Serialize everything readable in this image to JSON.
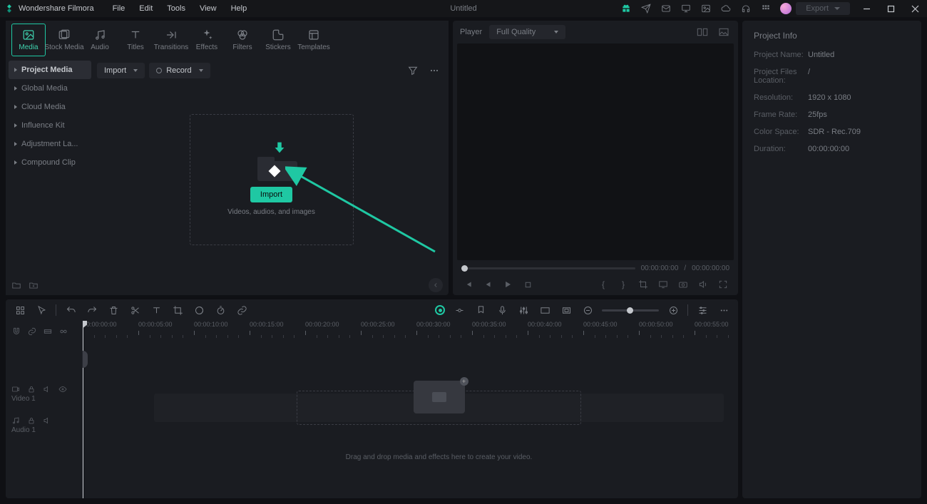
{
  "app": {
    "name": "Wondershare Filmora",
    "document": "Untitled",
    "export": "Export"
  },
  "menu": [
    "File",
    "Edit",
    "Tools",
    "View",
    "Help"
  ],
  "tabs": [
    {
      "id": "media",
      "label": "Media"
    },
    {
      "id": "stock",
      "label": "Stock Media"
    },
    {
      "id": "audio",
      "label": "Audio"
    },
    {
      "id": "titles",
      "label": "Titles"
    },
    {
      "id": "transitions",
      "label": "Transitions"
    },
    {
      "id": "effects",
      "label": "Effects"
    },
    {
      "id": "filters",
      "label": "Filters"
    },
    {
      "id": "stickers",
      "label": "Stickers"
    },
    {
      "id": "templates",
      "label": "Templates"
    }
  ],
  "media_sidebar": [
    "Project Media",
    "Global Media",
    "Cloud Media",
    "Influence Kit",
    "Adjustment La...",
    "Compound Clip"
  ],
  "media_toolbar": {
    "import": "Import",
    "record": "Record"
  },
  "dropzone": {
    "button": "Import",
    "hint": "Videos, audios, and images"
  },
  "player": {
    "label": "Player",
    "quality": "Full Quality",
    "time_current": "00:00:00:00",
    "time_total": "00:00:00:00",
    "sep": "/"
  },
  "inspector": {
    "title": "Project Info",
    "rows": [
      {
        "k": "Project Name:",
        "v": "Untitled"
      },
      {
        "k": "Project Files Location:",
        "v": "/"
      },
      {
        "k": "Resolution:",
        "v": "1920 x 1080"
      },
      {
        "k": "Frame Rate:",
        "v": "25fps"
      },
      {
        "k": "Color Space:",
        "v": "SDR - Rec.709"
      },
      {
        "k": "Duration:",
        "v": "00:00:00:00"
      }
    ]
  },
  "timeline": {
    "hint": "Drag and drop media and effects here to create your video.",
    "ticks": [
      "00:00:00:00",
      "00:00:05:00",
      "00:00:10:00",
      "00:00:15:00",
      "00:00:20:00",
      "00:00:25:00",
      "00:00:30:00",
      "00:00:35:00",
      "00:00:40:00",
      "00:00:45:00",
      "00:00:50:00",
      "00:00:55:00"
    ],
    "tracks": [
      {
        "name": "Video 1",
        "icon": "video"
      },
      {
        "name": "Audio 1",
        "icon": "audio"
      }
    ]
  }
}
